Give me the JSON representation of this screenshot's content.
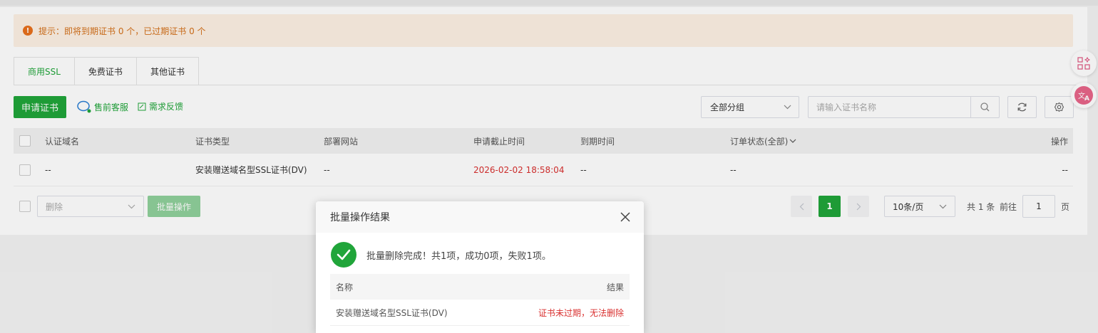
{
  "alert": {
    "icon": "warning-icon",
    "text": "提示：即将到期证书 0 个，已过期证书 0 个"
  },
  "tabs": [
    {
      "label": "商用SSL",
      "active": true
    },
    {
      "label": "免费证书",
      "active": false
    },
    {
      "label": "其他证书",
      "active": false
    }
  ],
  "toolbar": {
    "apply_label": "申请证书",
    "presale_label": "售前客服",
    "feedback_label": "需求反馈",
    "group_select": "全部分组",
    "search_placeholder": "请输入证书名称"
  },
  "table": {
    "headers": {
      "domain": "认证域名",
      "type": "证书类型",
      "site": "部署网站",
      "deadline": "申请截止时间",
      "expire": "到期时间",
      "status": "订单状态(全部)",
      "action": "操作"
    },
    "rows": [
      {
        "domain": "--",
        "type": "安装赠送域名型SSL证书(DV)",
        "site": "--",
        "deadline": "2026-02-02 18:58:04",
        "expire": "--",
        "status": "--",
        "action": "--"
      }
    ]
  },
  "batch": {
    "select_value": "删除",
    "button_label": "批量操作"
  },
  "pagination": {
    "current_page": "1",
    "page_size": "10条/页",
    "total_text": "共 1 条",
    "goto_text": "前往",
    "goto_value": "1",
    "page_unit": "页"
  },
  "dialog": {
    "title": "批量操作结果",
    "message": "批量删除完成！共1项，成功0项，失败1项。",
    "table_headers": {
      "name": "名称",
      "result": "结果"
    },
    "rows": [
      {
        "name": "安装赠送域名型SSL证书(DV)",
        "result": "证书未过期，无法删除"
      }
    ]
  },
  "colors": {
    "brand": "#20a53a",
    "warning": "#e8701c",
    "error": "#d9302f"
  }
}
